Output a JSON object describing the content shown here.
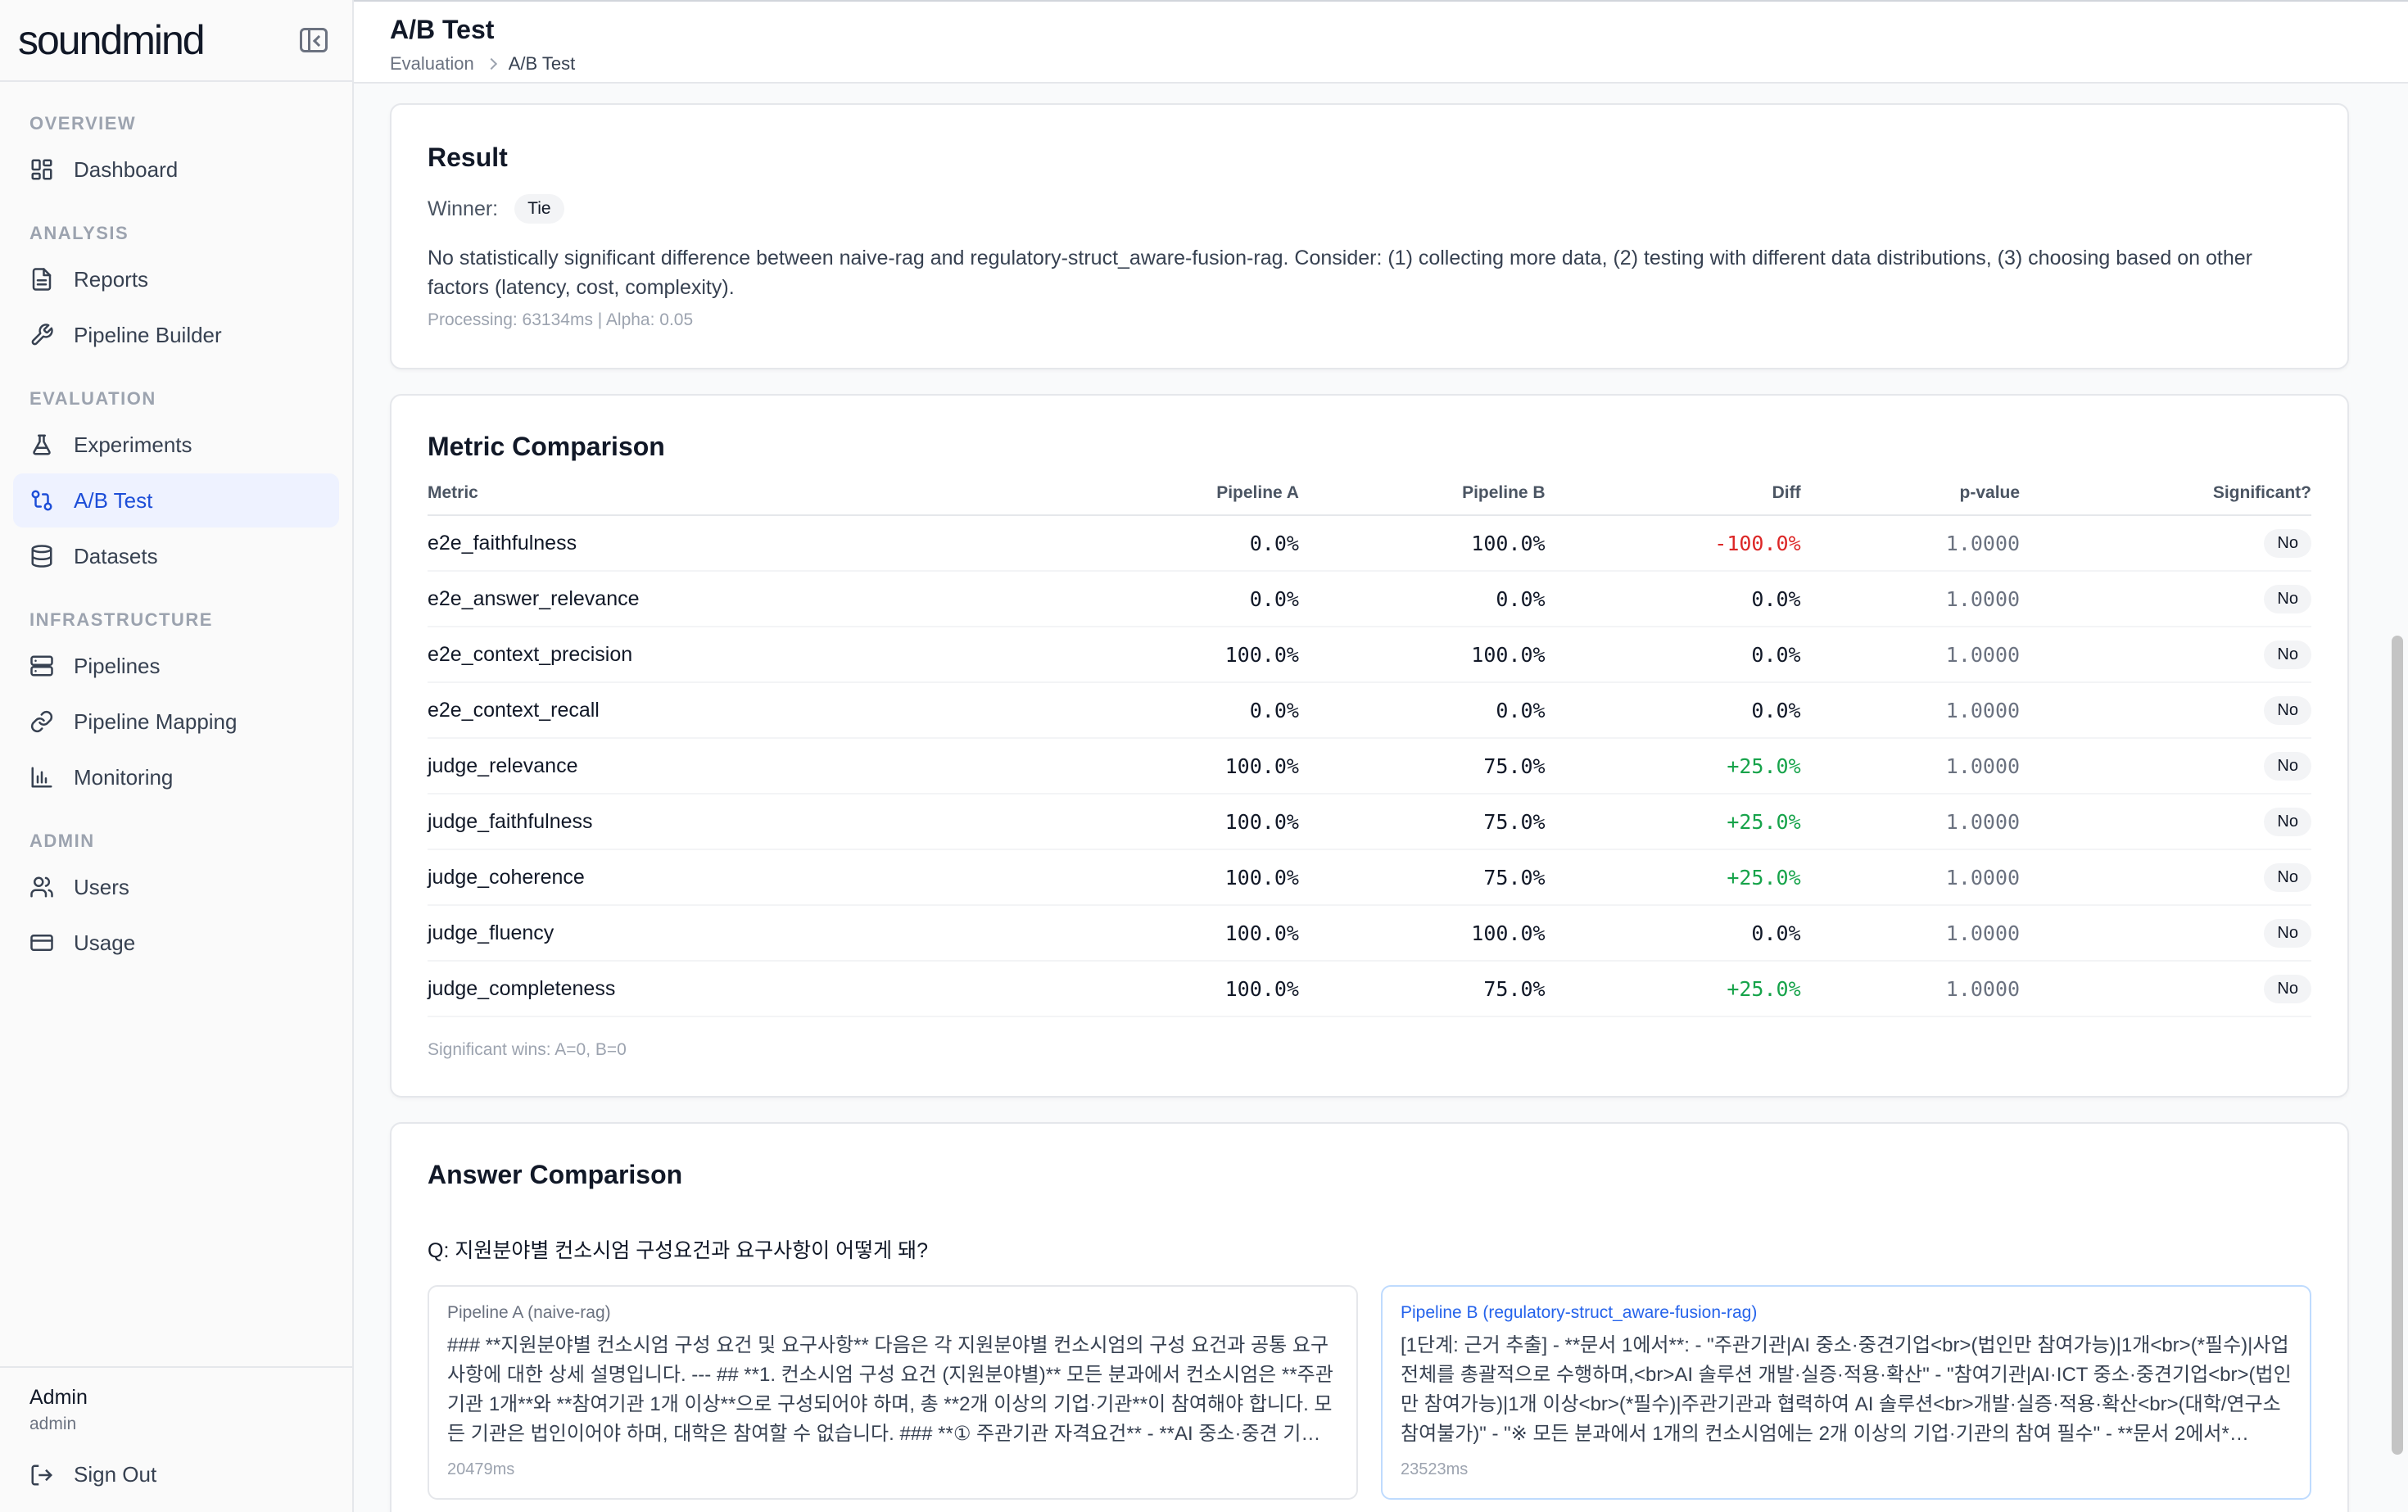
{
  "brand": {
    "name": "soundmind"
  },
  "sidebar": {
    "sections": [
      {
        "title": "OVERVIEW",
        "items": [
          {
            "label": "Dashboard",
            "icon": "dashboard-icon"
          }
        ]
      },
      {
        "title": "ANALYSIS",
        "items": [
          {
            "label": "Reports",
            "icon": "document-icon"
          },
          {
            "label": "Pipeline Builder",
            "icon": "wrench-icon"
          }
        ]
      },
      {
        "title": "EVALUATION",
        "items": [
          {
            "label": "Experiments",
            "icon": "flask-icon"
          },
          {
            "label": "A/B Test",
            "icon": "git-compare-icon",
            "active": true
          },
          {
            "label": "Datasets",
            "icon": "database-icon"
          }
        ]
      },
      {
        "title": "INFRASTRUCTURE",
        "items": [
          {
            "label": "Pipelines",
            "icon": "server-icon"
          },
          {
            "label": "Pipeline Mapping",
            "icon": "link-icon"
          },
          {
            "label": "Monitoring",
            "icon": "bar-chart-icon"
          }
        ]
      },
      {
        "title": "ADMIN",
        "items": [
          {
            "label": "Users",
            "icon": "users-icon"
          },
          {
            "label": "Usage",
            "icon": "credit-card-icon"
          }
        ]
      }
    ],
    "user": {
      "name": "Admin",
      "role": "admin"
    },
    "signout_label": "Sign Out"
  },
  "header": {
    "title": "A/B Test",
    "breadcrumb": {
      "parent": "Evaluation",
      "current": "A/B Test"
    }
  },
  "result": {
    "title": "Result",
    "winner_label": "Winner:",
    "winner": "Tie",
    "message": "No statistically significant difference between naive-rag and regulatory-struct_aware-fusion-rag. Consider: (1) collecting more data, (2) testing with different data distributions, (3) choosing based on other factors (latency, cost, complexity).",
    "meta": "Processing: 63134ms | Alpha: 0.05"
  },
  "metric_comparison": {
    "title": "Metric Comparison",
    "columns": [
      "Metric",
      "Pipeline A",
      "Pipeline B",
      "Diff",
      "p-value",
      "Significant?"
    ],
    "rows": [
      {
        "metric": "e2e_faithfulness",
        "a": "0.0%",
        "b": "100.0%",
        "diff": "-100.0%",
        "diff_sign": "neg",
        "p": "1.0000",
        "sig": "No"
      },
      {
        "metric": "e2e_answer_relevance",
        "a": "0.0%",
        "b": "0.0%",
        "diff": "0.0%",
        "diff_sign": "zero",
        "p": "1.0000",
        "sig": "No"
      },
      {
        "metric": "e2e_context_precision",
        "a": "100.0%",
        "b": "100.0%",
        "diff": "0.0%",
        "diff_sign": "zero",
        "p": "1.0000",
        "sig": "No"
      },
      {
        "metric": "e2e_context_recall",
        "a": "0.0%",
        "b": "0.0%",
        "diff": "0.0%",
        "diff_sign": "zero",
        "p": "1.0000",
        "sig": "No"
      },
      {
        "metric": "judge_relevance",
        "a": "100.0%",
        "b": "75.0%",
        "diff": "+25.0%",
        "diff_sign": "pos",
        "p": "1.0000",
        "sig": "No"
      },
      {
        "metric": "judge_faithfulness",
        "a": "100.0%",
        "b": "75.0%",
        "diff": "+25.0%",
        "diff_sign": "pos",
        "p": "1.0000",
        "sig": "No"
      },
      {
        "metric": "judge_coherence",
        "a": "100.0%",
        "b": "75.0%",
        "diff": "+25.0%",
        "diff_sign": "pos",
        "p": "1.0000",
        "sig": "No"
      },
      {
        "metric": "judge_fluency",
        "a": "100.0%",
        "b": "100.0%",
        "diff": "0.0%",
        "diff_sign": "zero",
        "p": "1.0000",
        "sig": "No"
      },
      {
        "metric": "judge_completeness",
        "a": "100.0%",
        "b": "75.0%",
        "diff": "+25.0%",
        "diff_sign": "pos",
        "p": "1.0000",
        "sig": "No"
      }
    ],
    "summary": "Significant wins: A=0, B=0"
  },
  "answer_comparison": {
    "title": "Answer Comparison",
    "question": "Q: 지원분야별 컨소시엄 구성요건과 요구사항이 어떻게 돼?",
    "pipeline_a": {
      "label": "Pipeline A (naive-rag)",
      "text": "### **지원분야별 컨소시엄 구성 요건 및 요구사항** 다음은 각 지원분야별 컨소시엄의 구성 요건과 공통 요구사항에 대한 상세 설명입니다. --- ## **1. 컨소시엄 구성 요건 (지원분야별)** 모든 분과에서 컨소시엄은 **주관기관 1개**와 **참여기관 1개 이상**으로 구성되어야 하며, 총 **2개 이상의 기업·기관**이 참여해야 합니다. 모든 기관은 법인이어야 하며, 대학은 참여할 수 없습니다. ### **① 주관기관 자격요건** - **AI 중소·중견 기…",
      "time": "20479ms"
    },
    "pipeline_b": {
      "label": "Pipeline B (regulatory-struct_aware-fusion-rag)",
      "text": "[1단계: 근거 추출] - **문서 1에서**: - \"주관기관|AI 중소·중견기업<br>(법인만 참여가능)|1개<br>(*필수)|사업 전체를 총괄적으로 수행하며,<br>AI 솔루션 개발·실증·적용·확산\" - \"참여기관|AI·ICT 중소·중견기업<br>(법인만 참여가능)|1개 이상<br>(*필수)|주관기관과 협력하여 AI 솔루션<br>개발·실증·적용·확산<br>(대학/연구소 참여불가)\" - \"※ 모든 분과에서 1개의 컨소시엄에는 2개 이상의 기업·기관의 참여 필수\" - **문서 2에서*…",
      "time": "23523ms"
    }
  },
  "colors": {
    "accent": "#1d4ed8",
    "positive": "#16a34a",
    "negative": "#dc2626"
  }
}
